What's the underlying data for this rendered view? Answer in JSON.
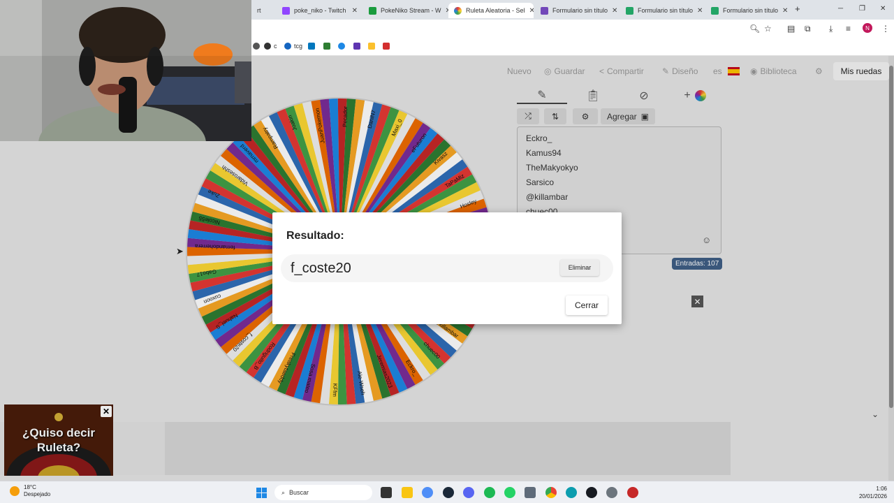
{
  "browser": {
    "tabs": [
      {
        "label": "rt",
        "color": "#6b4c9a"
      },
      {
        "label": "poke_niko - Twitch",
        "color": "#9146ff"
      },
      {
        "label": "PokeNiko Stream - W",
        "color": "#1a9c3e"
      },
      {
        "label": "Ruleta Aleatoria - Sel",
        "color": "#e53935"
      },
      {
        "label": "Formulario sin título",
        "color": "#7248b9"
      },
      {
        "label": "Formulario sin título",
        "color": "#23a566"
      },
      {
        "label": "Formulario sin título",
        "color": "#23a566"
      }
    ],
    "new_tab": "+",
    "bookmarks": [
      "c",
      "tcg"
    ]
  },
  "app": {
    "nav": {
      "nuevo": "Nuevo",
      "guardar": "Guardar",
      "compartir": "Compartir",
      "diseno": "Diseño",
      "lang": "es",
      "biblioteca": "Biblioteca",
      "mis_ruedas": "Mis ruedas"
    },
    "editor": {
      "agregar": "Agregar",
      "entries": [
        "Eckro_",
        "Kamus94",
        "TheMakyokyo",
        "Sarsico",
        "@killambar",
        "chuec00"
      ],
      "entries_badge": "Entradas: 107"
    },
    "wheel": {
      "slice_colors": [
        "#2f6eba",
        "#e53935",
        "#43a047",
        "#fdd835",
        "#f0f0f0",
        "#ef6c00",
        "#7b2d9a",
        "#1e88e5",
        "#c62828",
        "#2e7d32",
        "#f9a825",
        "#ffffff"
      ],
      "slice_labels": [
        "Kamus94",
        "TheMakyokyo",
        "Sarsico",
        "@killambar",
        "chuec00",
        "Eckro_",
        "Jeremias2023",
        "Ale-Wseh",
        "KFfm",
        "Sosa mateo",
        "Freakytaeddy",
        "Rodriguito_B",
        "f_coste20",
        "Nahuel_S",
        "cuxoon",
        "Gabo17",
        "fernandoherrera",
        "Nicole55",
        "Zuke",
        "Vidaroseshh",
        "mrnaverd",
        "Rampatry",
        "Joakin",
        "JuanPokemon",
        "Pecador",
        "DaniN7",
        "Maxi_0",
        "eFuturon",
        "Kivasz",
        "TaPaMiz",
        "Hosley",
        "Ecoban"
      ]
    },
    "dialog": {
      "title": "Resultado:",
      "result": "f_coste20",
      "delete_label": "Eliminar",
      "close_label": "Cerrar"
    }
  },
  "ad": {
    "text_line1": "¿Quiso decir",
    "text_line2": "Ruleta?"
  },
  "taskbar": {
    "temperature": "18°C",
    "weather_desc": "Despejado",
    "search_placeholder": "Buscar",
    "time": "1:06",
    "date": "20/01/2026"
  }
}
